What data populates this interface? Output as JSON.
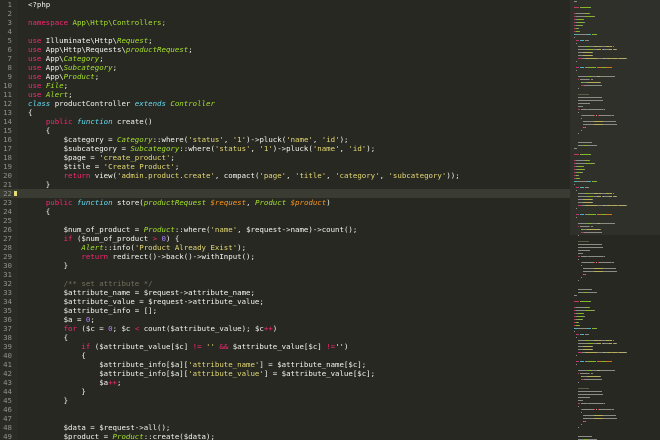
{
  "editor": {
    "language": "php",
    "active_line": 22,
    "colors": {
      "background": "#272822",
      "text": "#f8f8f2",
      "keyword": "#f92672",
      "string": "#e6db74",
      "number": "#ae81ff",
      "function": "#66d9ef",
      "class": "#a6e22e",
      "parameter": "#fd971f",
      "comment": "#75715e",
      "line_number": "#8f908a"
    },
    "lines": [
      {
        "n": "1",
        "t": [
          [
            "<?php",
            ""
          ]
        ]
      },
      {
        "n": "2",
        "t": []
      },
      {
        "n": "3",
        "t": [
          [
            "namespace",
            "k"
          ],
          [
            " App\\Http\\Controllers;",
            "c"
          ]
        ]
      },
      {
        "n": "4",
        "t": []
      },
      {
        "n": "5",
        "t": [
          [
            "use",
            "k"
          ],
          [
            " Illuminate\\Http\\",
            ""
          ],
          [
            "Request",
            "ci"
          ],
          [
            ";",
            ""
          ]
        ]
      },
      {
        "n": "6",
        "t": [
          [
            "use",
            "k"
          ],
          [
            " App\\Http\\Requests\\",
            ""
          ],
          [
            "productRequest",
            "ci"
          ],
          [
            ";",
            ""
          ]
        ]
      },
      {
        "n": "7",
        "t": [
          [
            "use",
            "k"
          ],
          [
            " App\\",
            ""
          ],
          [
            "Category",
            "ci"
          ],
          [
            ";",
            ""
          ]
        ]
      },
      {
        "n": "8",
        "t": [
          [
            "use",
            "k"
          ],
          [
            " App\\",
            ""
          ],
          [
            "Subcategory",
            "ci"
          ],
          [
            ";",
            ""
          ]
        ]
      },
      {
        "n": "9",
        "t": [
          [
            "use",
            "k"
          ],
          [
            " App\\",
            ""
          ],
          [
            "Product",
            "ci"
          ],
          [
            ";",
            ""
          ]
        ]
      },
      {
        "n": "10",
        "t": [
          [
            "use",
            "k"
          ],
          [
            " ",
            ""
          ],
          [
            "File",
            "ci"
          ],
          [
            ";",
            ""
          ]
        ]
      },
      {
        "n": "11",
        "t": [
          [
            "use",
            "k"
          ],
          [
            " ",
            ""
          ],
          [
            "Alert",
            "ci"
          ],
          [
            ";",
            ""
          ]
        ]
      },
      {
        "n": "12",
        "t": [
          [
            "class",
            "fi"
          ],
          [
            " productController ",
            ""
          ],
          [
            "extends",
            "fi"
          ],
          [
            " ",
            ""
          ],
          [
            "Controller",
            "ci"
          ]
        ]
      },
      {
        "n": "13",
        "t": [
          [
            "{",
            ""
          ]
        ]
      },
      {
        "n": "14",
        "t": [
          [
            "    ",
            ""
          ],
          [
            "public",
            "k"
          ],
          [
            " ",
            ""
          ],
          [
            "function",
            "fi"
          ],
          [
            " create()",
            ""
          ]
        ]
      },
      {
        "n": "15",
        "t": [
          [
            "    {",
            ""
          ]
        ]
      },
      {
        "n": "16",
        "t": [
          [
            "        $category = ",
            ""
          ],
          [
            "Category",
            "ci"
          ],
          [
            "::where(",
            ""
          ],
          [
            "'status'",
            "s"
          ],
          [
            ", ",
            ""
          ],
          [
            "'1'",
            "s"
          ],
          [
            ")->pluck(",
            ""
          ],
          [
            "'name'",
            "s"
          ],
          [
            ", ",
            ""
          ],
          [
            "'id'",
            "s"
          ],
          [
            ");",
            ""
          ]
        ]
      },
      {
        "n": "17",
        "t": [
          [
            "        $subcategory = ",
            ""
          ],
          [
            "Subcategory",
            "ci"
          ],
          [
            "::where(",
            ""
          ],
          [
            "'status'",
            "s"
          ],
          [
            ", ",
            ""
          ],
          [
            "'1'",
            "s"
          ],
          [
            ")->pluck(",
            ""
          ],
          [
            "'name'",
            "s"
          ],
          [
            ", ",
            ""
          ],
          [
            "'id'",
            "s"
          ],
          [
            ");",
            ""
          ]
        ]
      },
      {
        "n": "18",
        "t": [
          [
            "        $page = ",
            ""
          ],
          [
            "'create_product'",
            "s"
          ],
          [
            ";",
            ""
          ]
        ]
      },
      {
        "n": "19",
        "t": [
          [
            "        $title = ",
            ""
          ],
          [
            "'Create Product'",
            "s"
          ],
          [
            ";",
            ""
          ]
        ]
      },
      {
        "n": "20",
        "t": [
          [
            "        ",
            ""
          ],
          [
            "return",
            "k"
          ],
          [
            " view(",
            ""
          ],
          [
            "'admin.product.create'",
            "s"
          ],
          [
            ", compact(",
            ""
          ],
          [
            "'page'",
            "s"
          ],
          [
            ", ",
            ""
          ],
          [
            "'title'",
            "s"
          ],
          [
            ", ",
            ""
          ],
          [
            "'category'",
            "s"
          ],
          [
            ", ",
            ""
          ],
          [
            "'subcategory'",
            "s"
          ],
          [
            "));",
            ""
          ]
        ]
      },
      {
        "n": "21",
        "t": [
          [
            "    }",
            ""
          ]
        ]
      },
      {
        "n": "22",
        "t": []
      },
      {
        "n": "23",
        "t": [
          [
            "    ",
            ""
          ],
          [
            "public",
            "k"
          ],
          [
            " ",
            ""
          ],
          [
            "function",
            "fi"
          ],
          [
            " store(",
            ""
          ],
          [
            "productRequest",
            "ci"
          ],
          [
            " ",
            ""
          ],
          [
            "$request",
            "p"
          ],
          [
            ", ",
            ""
          ],
          [
            "Product",
            "ci"
          ],
          [
            " ",
            ""
          ],
          [
            "$product",
            "p"
          ],
          [
            ")",
            ""
          ]
        ]
      },
      {
        "n": "24",
        "t": [
          [
            "    {",
            ""
          ]
        ]
      },
      {
        "n": "25",
        "t": []
      },
      {
        "n": "26",
        "t": [
          [
            "        $num_of_product = ",
            ""
          ],
          [
            "Product",
            "ci"
          ],
          [
            "::where(",
            ""
          ],
          [
            "'name'",
            "s"
          ],
          [
            ", $request->name)->count();",
            ""
          ]
        ]
      },
      {
        "n": "27",
        "t": [
          [
            "        ",
            ""
          ],
          [
            "if",
            "k"
          ],
          [
            " ($num_of_product ",
            ""
          ],
          [
            ">",
            "k"
          ],
          [
            " ",
            ""
          ],
          [
            "0",
            "n"
          ],
          [
            ") {",
            ""
          ]
        ]
      },
      {
        "n": "28",
        "t": [
          [
            "            ",
            ""
          ],
          [
            "Alert",
            "ci"
          ],
          [
            "::info(",
            ""
          ],
          [
            "'Product Already Exist'",
            "s"
          ],
          [
            ");",
            ""
          ]
        ]
      },
      {
        "n": "29",
        "t": [
          [
            "            ",
            ""
          ],
          [
            "return",
            "k"
          ],
          [
            " redirect()->back()->withInput();",
            ""
          ]
        ]
      },
      {
        "n": "30",
        "t": [
          [
            "        }",
            ""
          ]
        ]
      },
      {
        "n": "31",
        "t": []
      },
      {
        "n": "32",
        "t": [
          [
            "        /** set attribute */",
            "cm"
          ]
        ]
      },
      {
        "n": "33",
        "t": [
          [
            "        $attribute_name = $request->attribute_name;",
            ""
          ]
        ]
      },
      {
        "n": "34",
        "t": [
          [
            "        $attribute_value = $request->attribute_value;",
            ""
          ]
        ]
      },
      {
        "n": "35",
        "t": [
          [
            "        $attribute_info = [];",
            ""
          ]
        ]
      },
      {
        "n": "36",
        "t": [
          [
            "        $a = ",
            ""
          ],
          [
            "0",
            "n"
          ],
          [
            ";",
            ""
          ]
        ]
      },
      {
        "n": "37",
        "t": [
          [
            "        ",
            ""
          ],
          [
            "for",
            "k"
          ],
          [
            " ($c = ",
            ""
          ],
          [
            "0",
            "n"
          ],
          [
            "; $c ",
            ""
          ],
          [
            "<",
            "k"
          ],
          [
            " count($attribute_value); $c",
            ""
          ],
          [
            "++",
            "k"
          ],
          [
            ")",
            ""
          ]
        ]
      },
      {
        "n": "38",
        "t": [
          [
            "        {",
            ""
          ]
        ]
      },
      {
        "n": "39",
        "t": [
          [
            "            ",
            ""
          ],
          [
            "if",
            "k"
          ],
          [
            " ($attribute_value[$c] ",
            ""
          ],
          [
            "!=",
            "k"
          ],
          [
            " ",
            ""
          ],
          [
            "''",
            "s"
          ],
          [
            " ",
            ""
          ],
          [
            "&&",
            "k"
          ],
          [
            " $attribute_value[$c] ",
            ""
          ],
          [
            "!=",
            "k"
          ],
          [
            "'')",
            ""
          ]
        ]
      },
      {
        "n": "40",
        "t": [
          [
            "            {",
            ""
          ]
        ]
      },
      {
        "n": "41",
        "t": [
          [
            "                $attribute_info[$a][",
            ""
          ],
          [
            "'attribute_name'",
            "s"
          ],
          [
            "] = $attribute_name[$c];",
            ""
          ]
        ]
      },
      {
        "n": "42",
        "t": [
          [
            "                $attribute_info[$a][",
            ""
          ],
          [
            "'attribute_value'",
            "s"
          ],
          [
            "] = $attribute_value[$c];",
            ""
          ]
        ]
      },
      {
        "n": "43",
        "t": [
          [
            "                $a",
            ""
          ],
          [
            "++",
            "k"
          ],
          [
            ";",
            ""
          ]
        ]
      },
      {
        "n": "44",
        "t": [
          [
            "            }",
            ""
          ]
        ]
      },
      {
        "n": "45",
        "t": [
          [
            "        }",
            ""
          ]
        ]
      },
      {
        "n": "46",
        "t": []
      },
      {
        "n": "47",
        "t": []
      },
      {
        "n": "48",
        "t": [
          [
            "        $data = $request->all();",
            ""
          ]
        ]
      },
      {
        "n": "49",
        "t": [
          [
            "        $product = ",
            ""
          ],
          [
            "Product",
            "ci"
          ],
          [
            "::create($data);",
            ""
          ]
        ]
      }
    ]
  }
}
